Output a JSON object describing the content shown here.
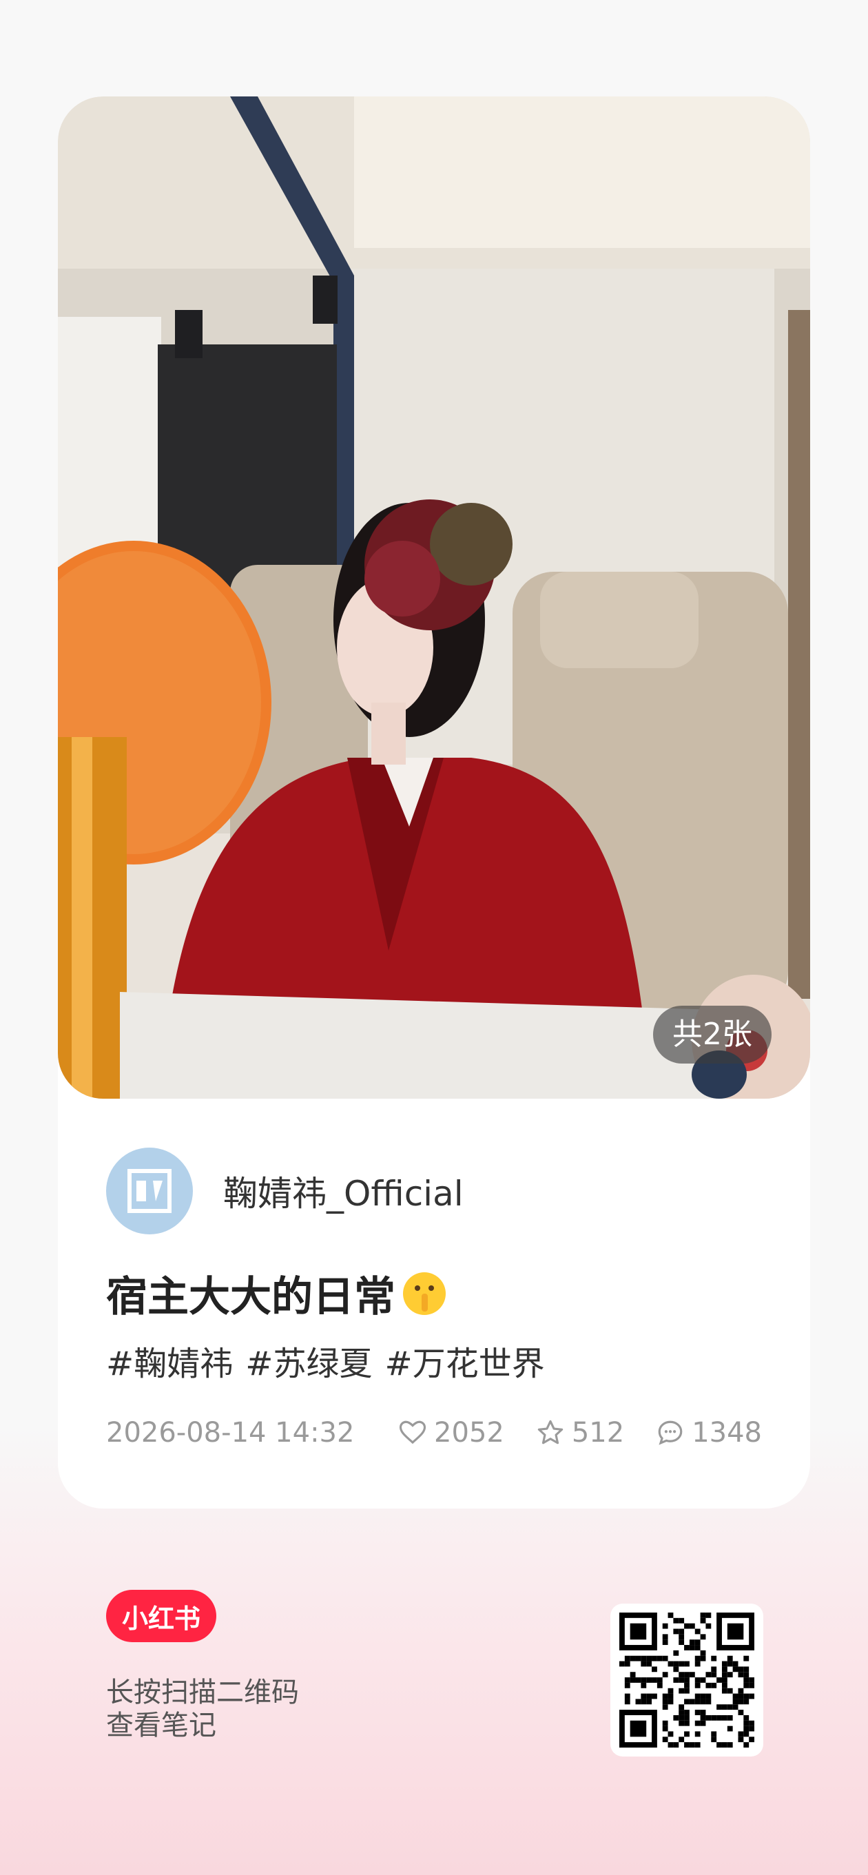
{
  "photo": {
    "count_label": "共2张"
  },
  "author": {
    "name": "鞠婧祎_Official",
    "avatar_icon": "avatar-logo-icon"
  },
  "post": {
    "title": "宿主大大的日常",
    "title_emoji": "shushing-face-emoji",
    "tags": [
      "#鞠婧祎",
      "#苏绿夏",
      "#万花世界"
    ],
    "date": "2026-08-14 14:32",
    "likes": "2052",
    "favorites": "512",
    "comments": "1348"
  },
  "footer": {
    "brand": "小红书",
    "scan_line1": "长按扫描二维码",
    "scan_line2": "查看笔记"
  },
  "colors": {
    "brand_red": "#ff2442",
    "avatar_bg": "#b3d1ea"
  }
}
